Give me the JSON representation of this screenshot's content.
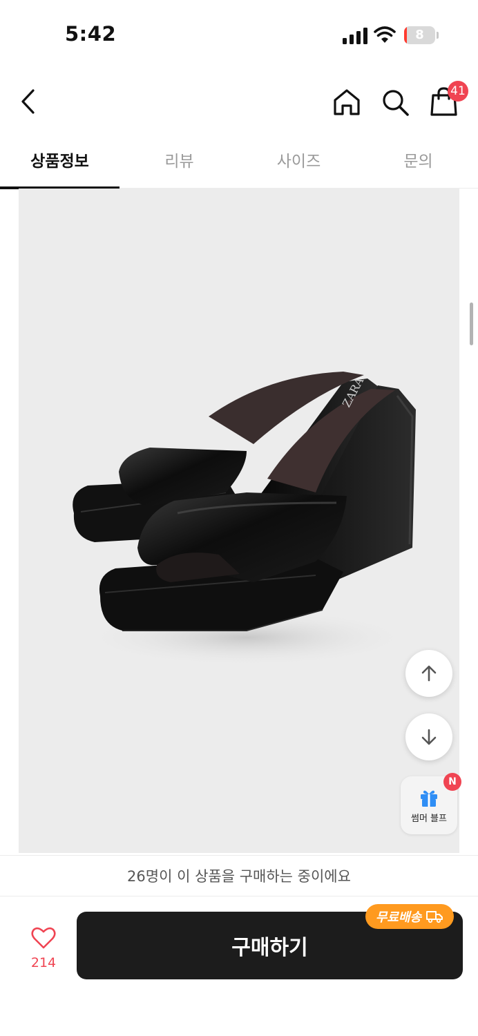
{
  "status_bar": {
    "time": "5:42",
    "battery_level": "8",
    "battery_fraction": 0.08
  },
  "header": {
    "icons": [
      "back-arrow-icon",
      "home-icon",
      "search-icon",
      "shopping-bag-icon"
    ],
    "cart_badge": "41"
  },
  "tabs": [
    {
      "label": "상품정보",
      "active": true
    },
    {
      "label": "리뷰",
      "active": false
    },
    {
      "label": "사이즈",
      "active": false
    },
    {
      "label": "문의",
      "active": false
    }
  ],
  "product_image": {
    "brand_mark": "ZARA"
  },
  "floating": {
    "gift_label": "썸머 블프",
    "gift_badge": "N"
  },
  "purchase_notice": "26명이 이 상품을 구매하는 중이에요",
  "bottom_bar": {
    "like_count": "214",
    "buy_label": "구매하기",
    "free_shipping_label": "무료배송"
  },
  "colors": {
    "accent_red": "#f04452",
    "badge_orange": "#ff9a1f",
    "buy_button": "#1c1c1c",
    "image_background": "#ececec"
  }
}
